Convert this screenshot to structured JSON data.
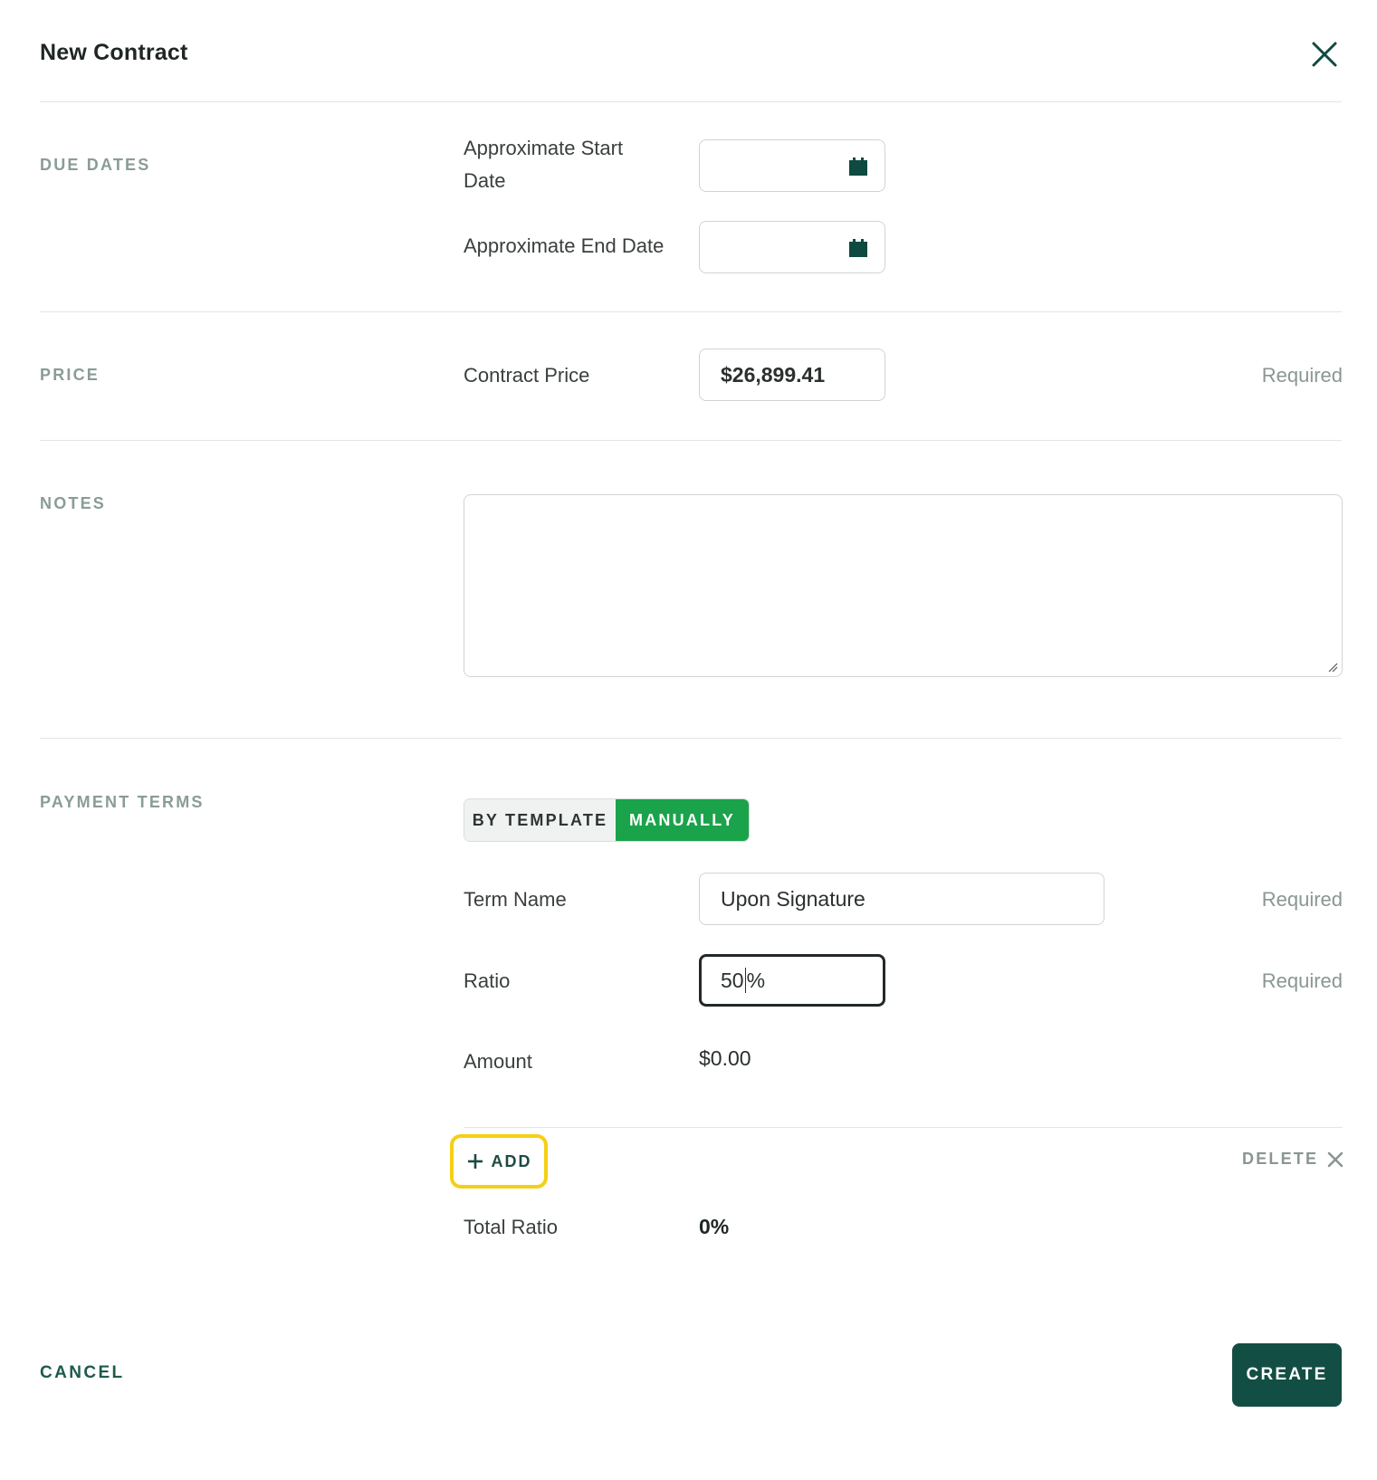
{
  "dialog": {
    "title": "New Contract"
  },
  "due_dates": {
    "section_label": "DUE DATES",
    "start_label_line1": "Approximate Start",
    "start_label_line2": "Date",
    "start_value": "",
    "end_label": "Approximate End Date",
    "end_value": ""
  },
  "price": {
    "section_label": "PRICE",
    "contract_price_label": "Contract Price",
    "contract_price_value": "$26,899.41",
    "required_text": "Required"
  },
  "notes": {
    "section_label": "NOTES",
    "value": ""
  },
  "payment_terms": {
    "section_label": "PAYMENT TERMS",
    "toggle": {
      "options": [
        "BY TEMPLATE",
        "MANUALLY"
      ],
      "selected": "MANUALLY"
    },
    "term_name_label": "Term Name",
    "term_name_value": "Upon Signature",
    "term_name_required": "Required",
    "ratio_label": "Ratio",
    "ratio_value_before_caret": "50",
    "ratio_value_after_caret": "%",
    "ratio_required": "Required",
    "amount_label": "Amount",
    "amount_value": "$0.00",
    "add_label": "ADD",
    "delete_label": "DELETE",
    "total_ratio_label": "Total Ratio",
    "total_ratio_value": "0%"
  },
  "footer": {
    "cancel_label": "CANCEL",
    "create_label": "CREATE"
  },
  "colors": {
    "accent_dark": "#134e44",
    "toggle_active": "#1aa34a",
    "focus_highlight": "#f5cf16",
    "section_label": "#8a9c97",
    "icon": "#0f4a40"
  },
  "icons": {
    "close": "close-icon",
    "calendar": "calendar-icon",
    "plus": "plus-icon",
    "delete": "close-small-icon"
  }
}
